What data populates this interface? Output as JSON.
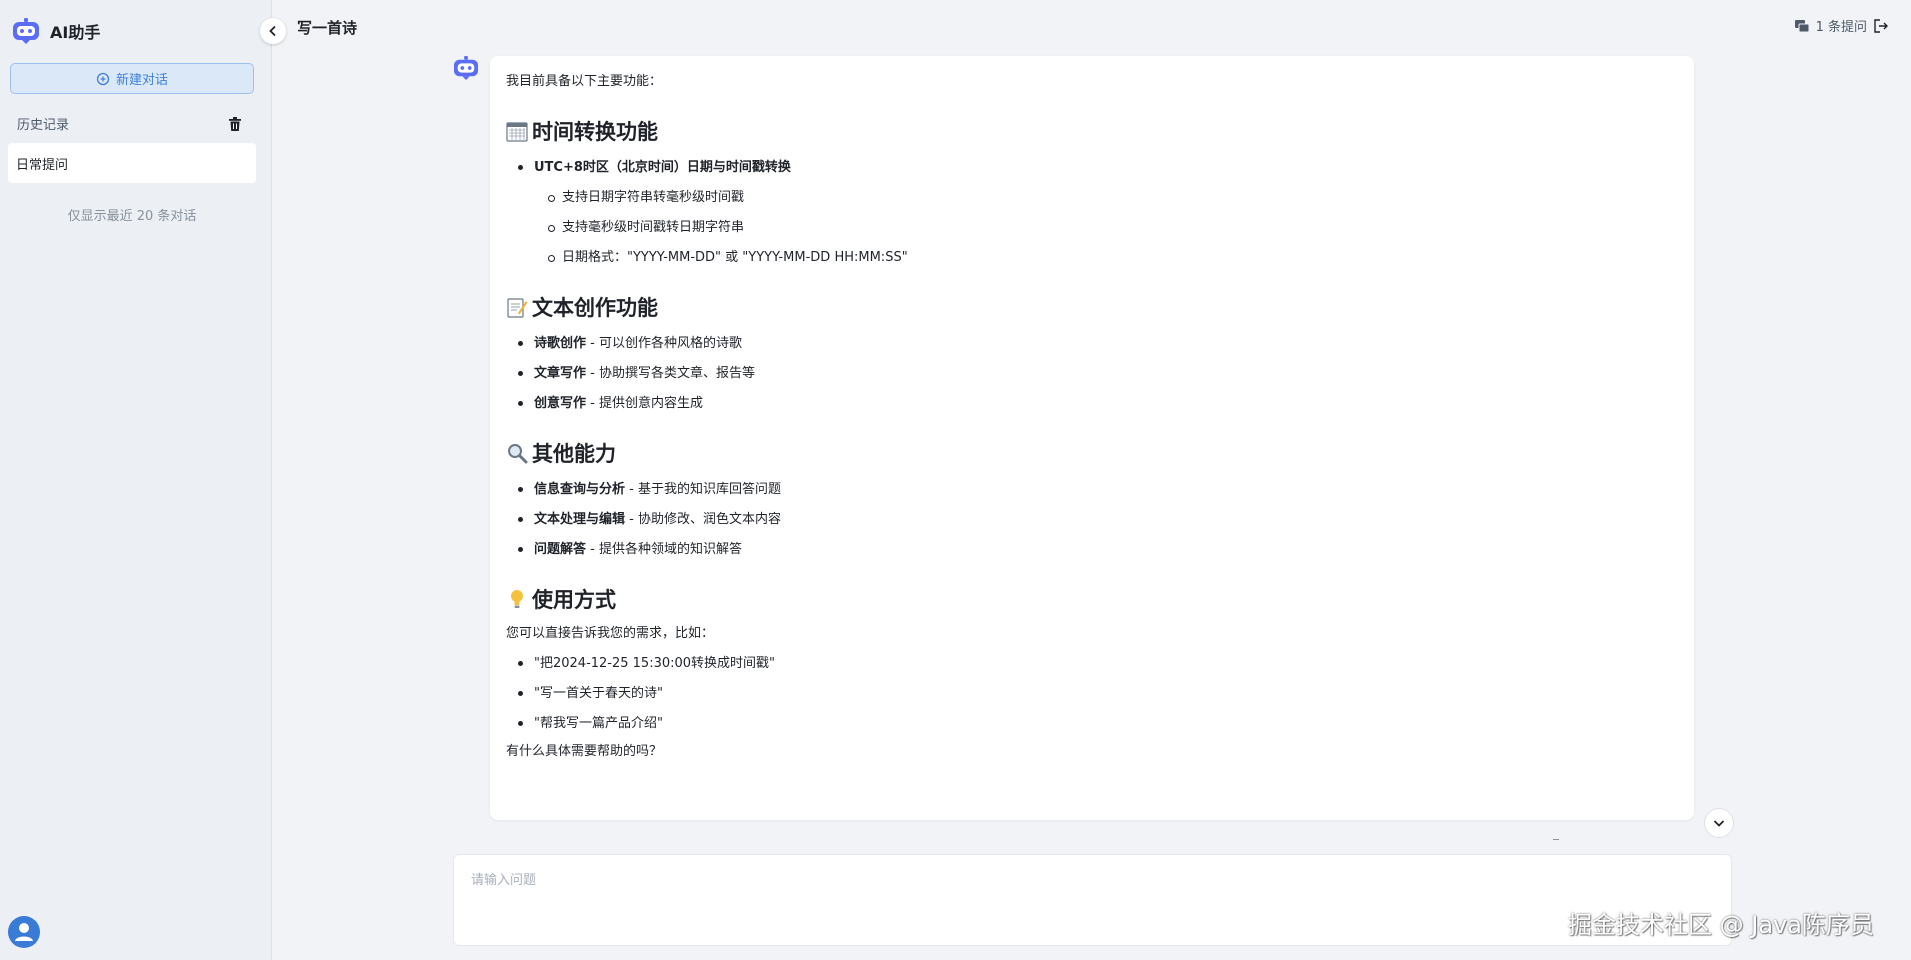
{
  "app": {
    "name": "AI助手"
  },
  "sidebar": {
    "new_chat_label": "新建对话",
    "history_title": "历史记录",
    "history_items": [
      {
        "label": "日常提问"
      }
    ],
    "history_note": "仅显示最近 20 条对话"
  },
  "header": {
    "title": "写一首诗",
    "question_count": "1 条提问"
  },
  "message": {
    "intro": "我目前具备以下主要功能：",
    "sections": [
      {
        "icon": "calendar-icon",
        "title": "时间转换功能",
        "items": [
          {
            "bold": "UTC+8时区（北京时间）日期与时间戳转换",
            "text": "",
            "subitems": [
              "支持日期字符串转毫秒级时间戳",
              "支持毫秒级时间戳转日期字符串",
              "日期格式：\"YYYY-MM-DD\" 或 \"YYYY-MM-DD HH:MM:SS\""
            ]
          }
        ]
      },
      {
        "icon": "memo-icon",
        "title": "文本创作功能",
        "items": [
          {
            "bold": "诗歌创作",
            "text": " - 可以创作各种风格的诗歌"
          },
          {
            "bold": "文章写作",
            "text": " - 协助撰写各类文章、报告等"
          },
          {
            "bold": "创意写作",
            "text": " - 提供创意内容生成"
          }
        ]
      },
      {
        "icon": "magnifier-icon",
        "title": "其他能力",
        "items": [
          {
            "bold": "信息查询与分析",
            "text": " - 基于我的知识库回答问题"
          },
          {
            "bold": "文本处理与编辑",
            "text": " - 协助修改、润色文本内容"
          },
          {
            "bold": "问题解答",
            "text": " - 提供各种领域的知识解答"
          }
        ]
      },
      {
        "icon": "lightbulb-icon",
        "title": "使用方式",
        "lead": "您可以直接告诉我您的需求，比如：",
        "items": [
          {
            "bold": "",
            "text": "\"把2024-12-25 15:30:00转换成时间戳\""
          },
          {
            "bold": "",
            "text": "\"写一首关于春天的诗\""
          },
          {
            "bold": "",
            "text": "\"帮我写一篇产品介绍\""
          }
        ]
      }
    ],
    "closing": "有什么具体需要帮助的吗？"
  },
  "input": {
    "placeholder": "请输入问题"
  },
  "watermark": "掘金技术社区 @ Java陈序员",
  "colors": {
    "accent": "#3f7fd6",
    "brand": "#5b6cf5"
  }
}
